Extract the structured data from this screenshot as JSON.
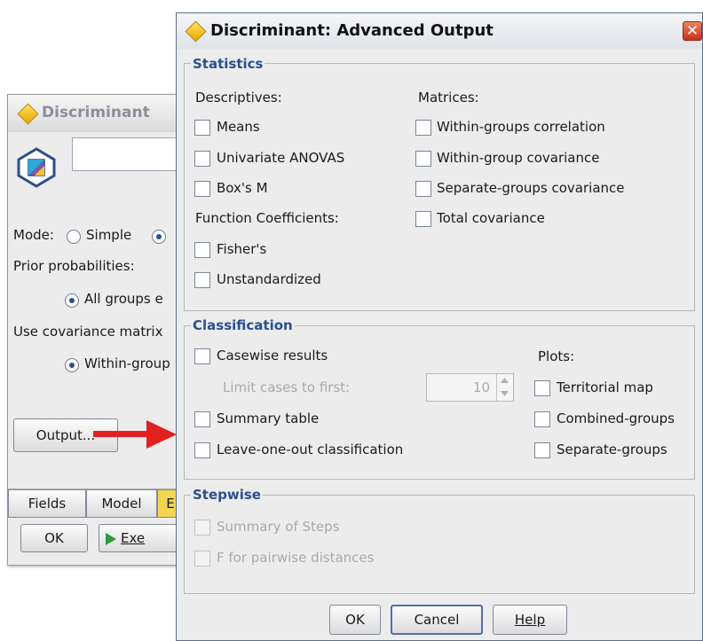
{
  "background_window": {
    "title": "Discriminant",
    "mode_label": "Mode:",
    "mode_simple": "Simple",
    "prior_label": "Prior probabilities:",
    "prior_option": "All groups e",
    "cov_label": "Use covariance matrix",
    "cov_option": "Within-group",
    "output_button": "Output...",
    "tabs": [
      "Fields",
      "Model",
      "E"
    ],
    "ok_button": "OK",
    "execute_button": "Exe"
  },
  "dialog": {
    "title": "Discriminant: Advanced Output",
    "close_glyph": "✕",
    "statistics": {
      "title": "Statistics",
      "descriptives_label": "Descriptives:",
      "means": "Means",
      "univariate": "Univariate ANOVAS",
      "boxm": "Box's M",
      "function_coeff_label": "Function Coefficients:",
      "fishers": "Fisher's",
      "unstandardized": "Unstandardized",
      "matrices_label": "Matrices:",
      "wg_corr": "Within-groups correlation",
      "wg_cov": "Within-group covariance",
      "sg_cov": "Separate-groups covariance",
      "total_cov": "Total covariance"
    },
    "classification": {
      "title": "Classification",
      "casewise": "Casewise results",
      "limit_label": "Limit cases to first:",
      "limit_value": "10",
      "summary_table": "Summary table",
      "leave_one_out": "Leave-one-out classification",
      "plots_label": "Plots:",
      "territorial": "Territorial map",
      "combined": "Combined-groups",
      "separate": "Separate-groups"
    },
    "stepwise": {
      "title": "Stepwise",
      "summary_steps": "Summary of Steps",
      "f_pairwise": "F for pairwise distances"
    },
    "buttons": {
      "ok": "OK",
      "cancel": "Cancel",
      "help": "Help"
    }
  },
  "colors": {
    "arrow": "#e32020",
    "group_title": "#2a4f8f",
    "accent_diamond": "#f3c21a"
  }
}
